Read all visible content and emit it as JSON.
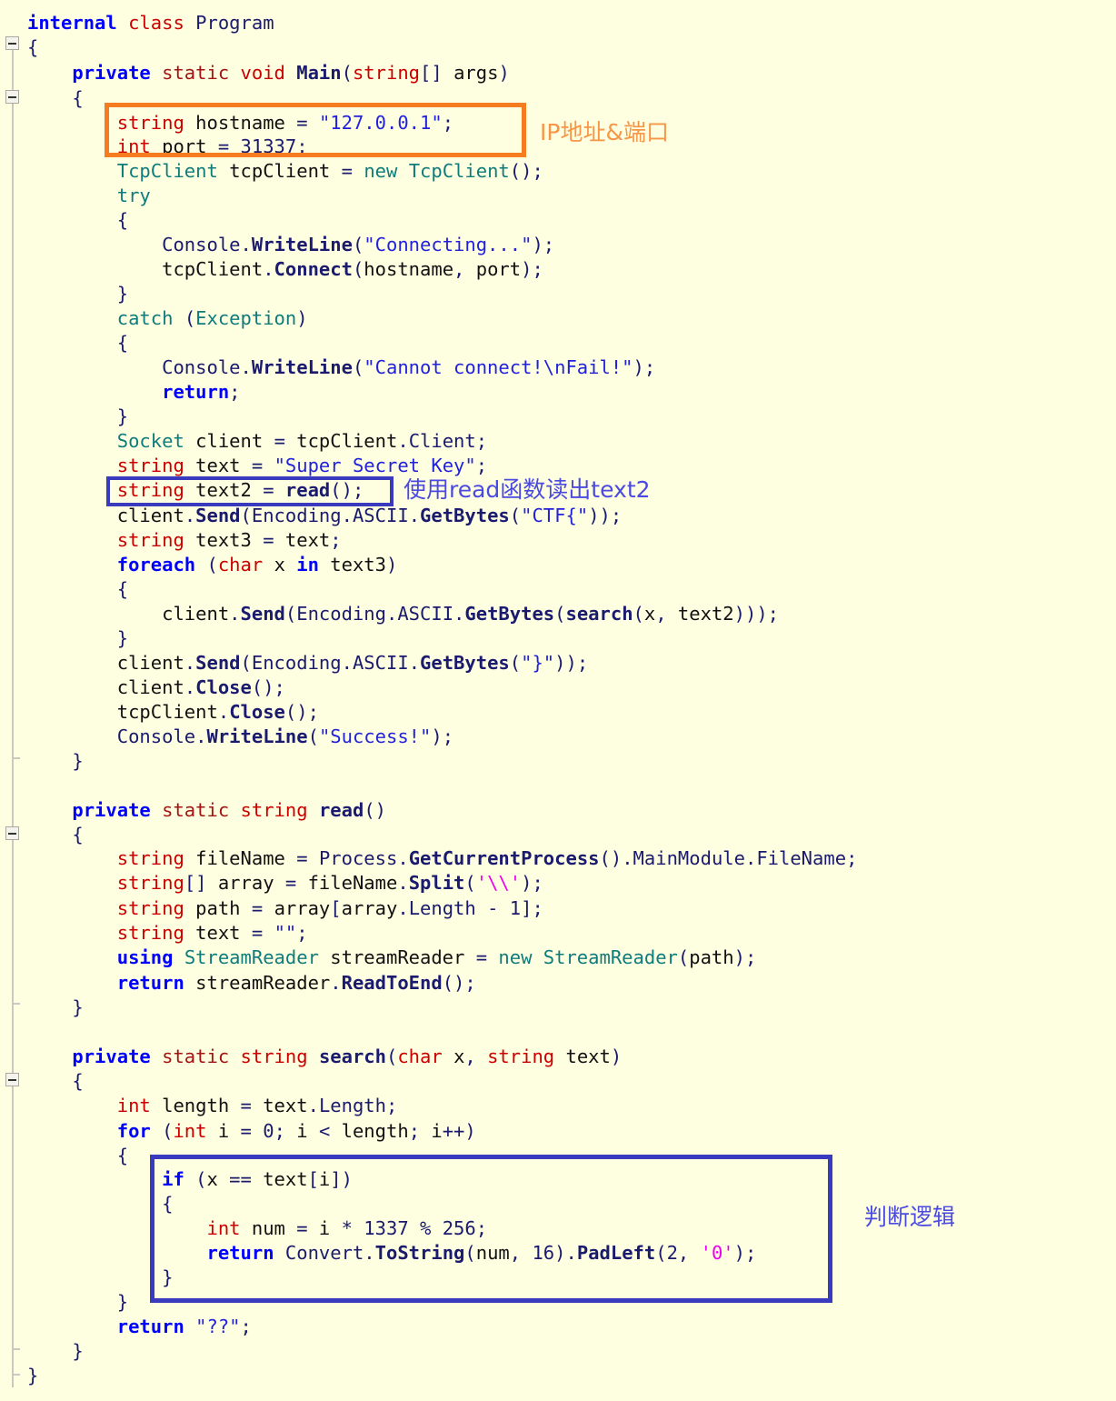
{
  "editor": {
    "language": "C#",
    "background_color": "#FEFEE0",
    "annotation_colors": {
      "orange": "#F57C20",
      "blue": "#3A3ABE"
    }
  },
  "code": {
    "lines": [
      "internal class Program",
      "{",
      "    private static void Main(string[] args)",
      "    {",
      "        string hostname = \"127.0.0.1\";",
      "        int port = 31337;",
      "        TcpClient tcpClient = new TcpClient();",
      "        try",
      "        {",
      "            Console.WriteLine(\"Connecting...\");",
      "            tcpClient.Connect(hostname, port);",
      "        }",
      "        catch (Exception)",
      "        {",
      "            Console.WriteLine(\"Cannot connect!\\nFail!\");",
      "            return;",
      "        }",
      "        Socket client = tcpClient.Client;",
      "        string text = \"Super Secret Key\";",
      "        string text2 = read();",
      "        client.Send(Encoding.ASCII.GetBytes(\"CTF{\"));",
      "        string text3 = text;",
      "        foreach (char x in text3)",
      "        {",
      "            client.Send(Encoding.ASCII.GetBytes(search(x, text2)));",
      "        }",
      "        client.Send(Encoding.ASCII.GetBytes(\"}\"));",
      "        client.Close();",
      "        tcpClient.Close();",
      "        Console.WriteLine(\"Success!\");",
      "    }",
      "",
      "    private static string read()",
      "    {",
      "        string fileName = Process.GetCurrentProcess().MainModule.FileName;",
      "        string[] array = fileName.Split('\\\\');",
      "        string path = array[array.Length - 1];",
      "        string text = \"\";",
      "        using StreamReader streamReader = new StreamReader(path);",
      "        return streamReader.ReadToEnd();",
      "    }",
      "",
      "    private static string search(char x, string text)",
      "    {",
      "        int length = text.Length;",
      "        for (int i = 0; i < length; i++)",
      "        {",
      "            if (x == text[i])",
      "            {",
      "                int num = i * 1337 % 256;",
      "                return Convert.ToString(num, 16).PadLeft(2, '0');",
      "            }",
      "        }",
      "        return \"??\";",
      "    }",
      "}"
    ]
  },
  "annotations": [
    {
      "id": "ip-port",
      "label": "IP地址&端口",
      "color": "#F79646",
      "box_color": "#F57C20"
    },
    {
      "id": "read-text2",
      "label": "使用read函数读出text2",
      "color": "#4A4AE0",
      "box_color": "#3A3ABE"
    },
    {
      "id": "logic",
      "label": "判断逻辑",
      "color": "#4A4AE0",
      "box_color": "#3A3ABE"
    }
  ],
  "values": {
    "hostname": "127.0.0.1",
    "port": "31337",
    "secret_key": "Super Secret Key",
    "flag_prefix": "CTF{",
    "flag_suffix": "}",
    "multiplier": "1337",
    "modulus": "256",
    "radix": "16",
    "pad_length": "2",
    "pad_char": "0",
    "fallback": "??",
    "connect_message": "Connecting...",
    "error_message": "Cannot connect!\\nFail!",
    "success_message": "Success!"
  }
}
